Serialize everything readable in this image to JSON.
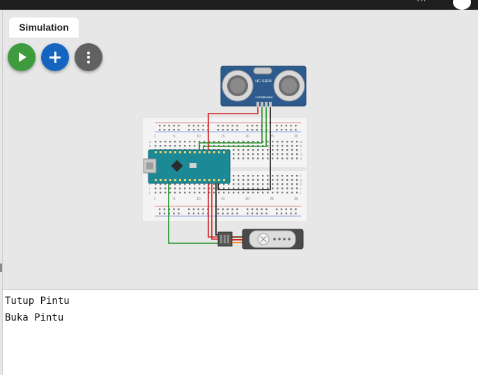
{
  "tabs": {
    "simulation_label": "Simulation"
  },
  "toolbar": {
    "play_icon": "play-icon",
    "add_icon": "plus-icon",
    "more_icon": "kebab-icon"
  },
  "topbar": {
    "menu_text": "···"
  },
  "components": {
    "sensor_label": "HC-SR04",
    "sensor_pins": [
      "VCC",
      "TRIG",
      "ECHO",
      "GND"
    ],
    "breadboard_numbers": [
      "1",
      "5",
      "10",
      "15",
      "20",
      "25",
      "30"
    ],
    "breadboard_rows_top": [
      "a",
      "b",
      "c",
      "d",
      "e"
    ],
    "breadboard_rows_bottom": [
      "f",
      "g",
      "h",
      "i",
      "j"
    ]
  },
  "colors": {
    "red_wire": "#d32020",
    "green_wire": "#1f8f1f",
    "black_wire": "#111111",
    "arduino_board": "#1b8a96",
    "sensor_board": "#2d5b8e"
  },
  "console": {
    "lines": [
      "Tutup Pintu",
      "Buka Pintu"
    ]
  }
}
